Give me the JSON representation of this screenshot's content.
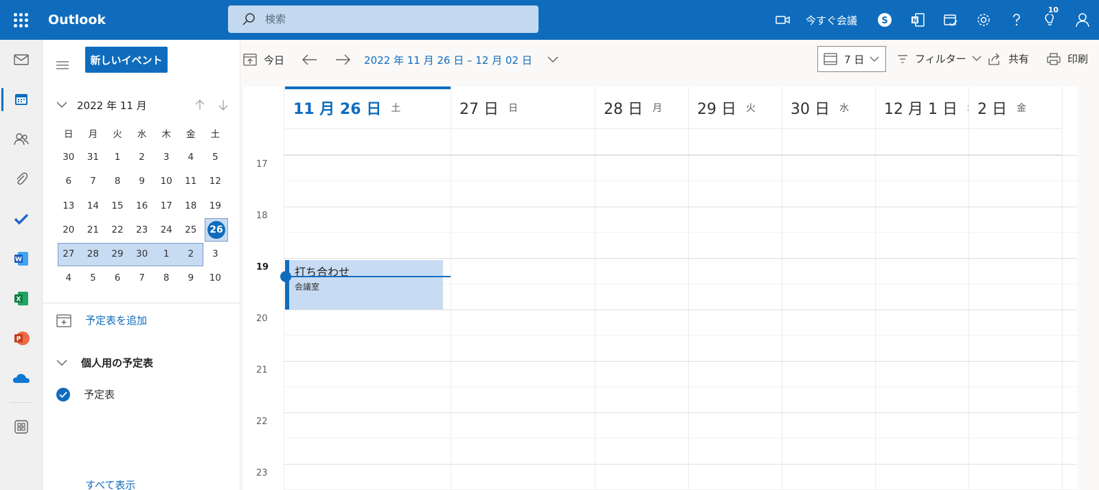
{
  "topbar": {
    "brand": "Outlook",
    "search_placeholder": "検索",
    "meet_now": "今すぐ会議",
    "tips_badge": "10"
  },
  "sidepane": {
    "new_event": "新しいイベント",
    "mini_month": "2022 年 11 月",
    "weekdays": [
      "日",
      "月",
      "火",
      "水",
      "木",
      "金",
      "土"
    ],
    "weeks": [
      [
        "30",
        "31",
        "1",
        "2",
        "3",
        "4",
        "5"
      ],
      [
        "6",
        "7",
        "8",
        "9",
        "10",
        "11",
        "12"
      ],
      [
        "13",
        "14",
        "15",
        "16",
        "17",
        "18",
        "19"
      ],
      [
        "20",
        "21",
        "22",
        "23",
        "24",
        "25",
        "26"
      ],
      [
        "27",
        "28",
        "29",
        "30",
        "1",
        "2",
        "3"
      ],
      [
        "4",
        "5",
        "6",
        "7",
        "8",
        "9",
        "10"
      ]
    ],
    "today_num": "26",
    "add_calendar": "予定表を追加",
    "group": "個人用の予定表",
    "calendar_item": "予定表",
    "show_all": "すべて表示"
  },
  "commandbar": {
    "today": "今日",
    "date_range": "2022 年 11 月 26 日 – 12 月 02 日",
    "view": "7 日",
    "filter": "フィルター",
    "share": "共有",
    "print": "印刷"
  },
  "calendar": {
    "days": [
      {
        "num": "11 月 26 日",
        "dow": "土",
        "today": true
      },
      {
        "num": "27 日",
        "dow": "日"
      },
      {
        "num": "28 日",
        "dow": "月"
      },
      {
        "num": "29 日",
        "dow": "火"
      },
      {
        "num": "30 日",
        "dow": "水"
      },
      {
        "num": "12 月 1 日",
        "dow": "木"
      },
      {
        "num": "2 日",
        "dow": "金"
      }
    ],
    "hours": [
      "17",
      "18",
      "19",
      "20",
      "21",
      "22",
      "23"
    ],
    "current_hour": "19",
    "event": {
      "title": "打ち合わせ",
      "location": "会議室"
    }
  },
  "colors": {
    "accent": "#0f6cbd",
    "event_bg": "#c7dcf3"
  }
}
